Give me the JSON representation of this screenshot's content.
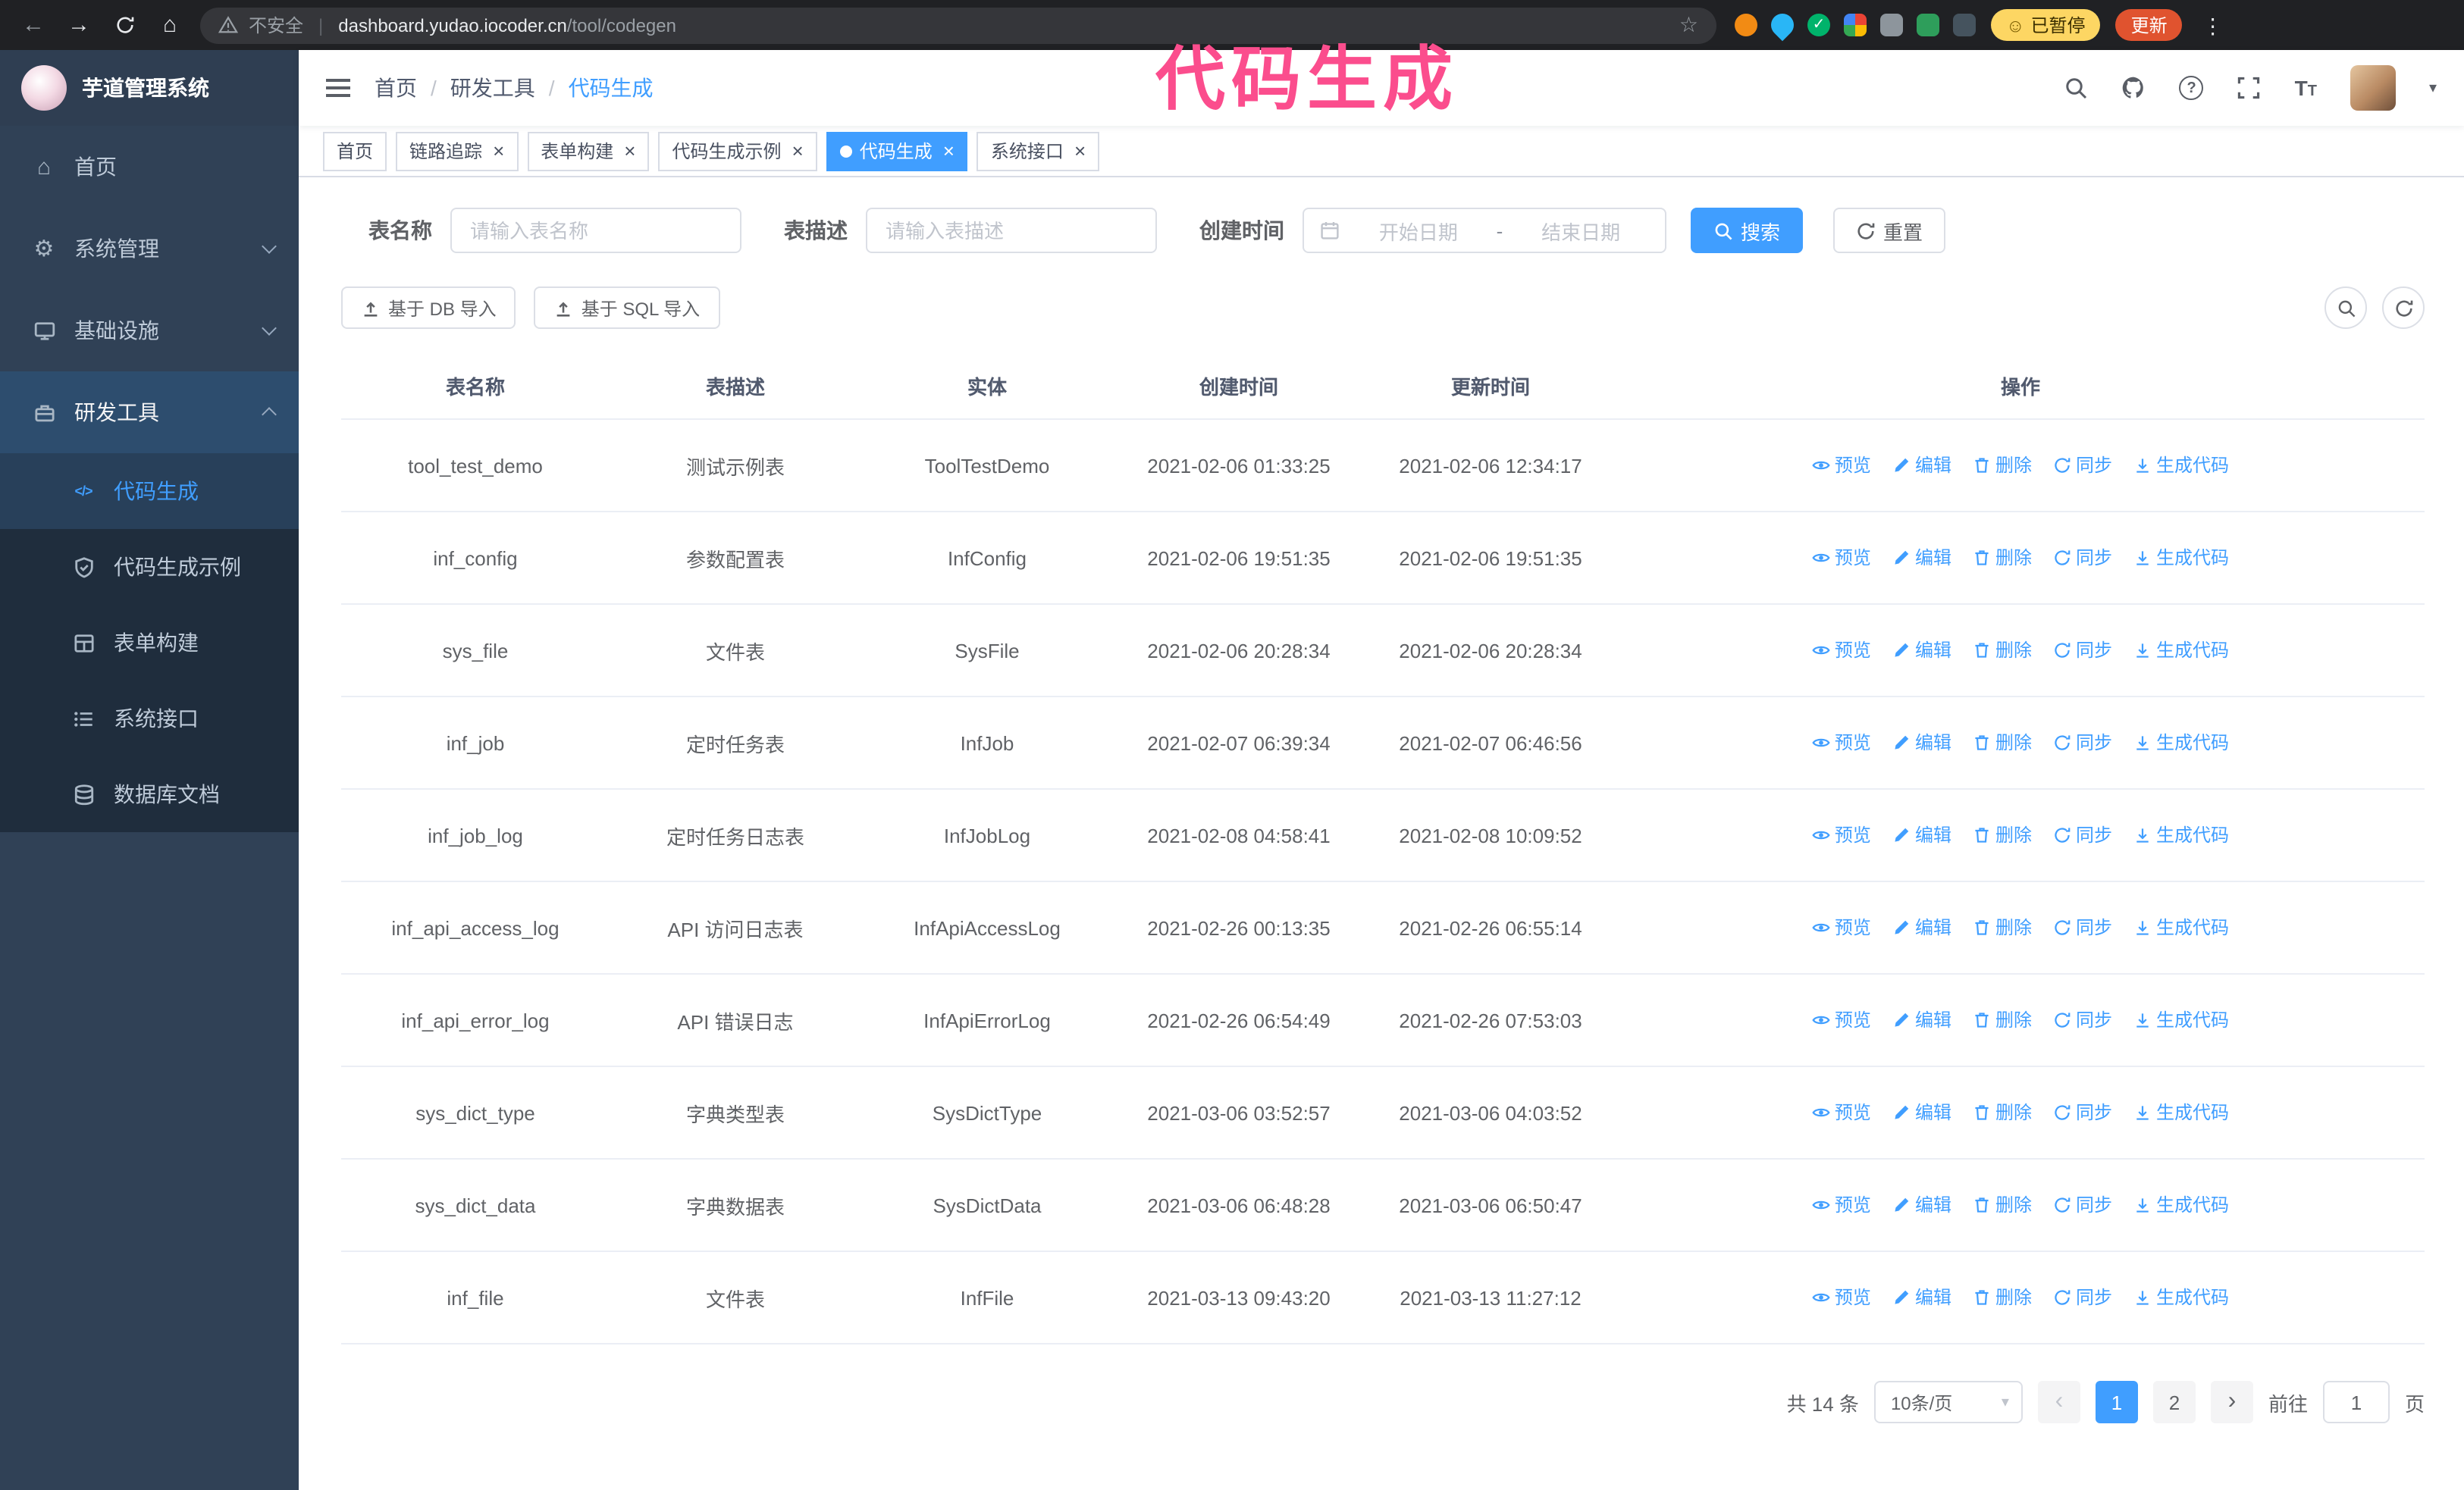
{
  "browser": {
    "security_text": "不安全",
    "url_domain": "dashboard.yudao.iocoder.cn",
    "url_path": "/tool/codegen",
    "paused_badge": "已暂停",
    "update_button": "更新"
  },
  "annotation": {
    "text": "代码生成",
    "color": "#fb4d8d"
  },
  "sidebar": {
    "logo_title": "芋道管理系统",
    "menu": [
      {
        "label": "首页"
      },
      {
        "label": "系统管理"
      },
      {
        "label": "基础设施"
      },
      {
        "label": "研发工具"
      }
    ],
    "submenu": [
      {
        "label": "代码生成"
      },
      {
        "label": "代码生成示例"
      },
      {
        "label": "表单构建"
      },
      {
        "label": "系统接口"
      },
      {
        "label": "数据库文档"
      }
    ]
  },
  "navbar": {
    "breadcrumb": [
      "首页",
      "研发工具",
      "代码生成"
    ]
  },
  "tabs": [
    {
      "label": "首页"
    },
    {
      "label": "链路追踪"
    },
    {
      "label": "表单构建"
    },
    {
      "label": "代码生成示例"
    },
    {
      "label": "代码生成"
    },
    {
      "label": "系统接口"
    }
  ],
  "filters": {
    "table_name_label": "表名称",
    "table_name_placeholder": "请输入表名称",
    "table_desc_label": "表描述",
    "table_desc_placeholder": "请输入表描述",
    "create_time_label": "创建时间",
    "date_start_placeholder": "开始日期",
    "date_separator": "-",
    "date_end_placeholder": "结束日期",
    "search_button": "搜索",
    "reset_button": "重置"
  },
  "toolbar": {
    "import_db_button": "基于 DB 导入",
    "import_sql_button": "基于 SQL 导入"
  },
  "table": {
    "columns": [
      "表名称",
      "表描述",
      "实体",
      "创建时间",
      "更新时间",
      "操作"
    ],
    "action_labels": [
      "预览",
      "编辑",
      "删除",
      "同步",
      "生成代码"
    ],
    "rows": [
      {
        "name": "tool_test_demo",
        "desc": "测试示例表",
        "entity": "ToolTestDemo",
        "created": "2021-02-06 01:33:25",
        "updated": "2021-02-06 12:34:17"
      },
      {
        "name": "inf_config",
        "desc": "参数配置表",
        "entity": "InfConfig",
        "created": "2021-02-06 19:51:35",
        "updated": "2021-02-06 19:51:35"
      },
      {
        "name": "sys_file",
        "desc": "文件表",
        "entity": "SysFile",
        "created": "2021-02-06 20:28:34",
        "updated": "2021-02-06 20:28:34"
      },
      {
        "name": "inf_job",
        "desc": "定时任务表",
        "entity": "InfJob",
        "created": "2021-02-07 06:39:34",
        "updated": "2021-02-07 06:46:56"
      },
      {
        "name": "inf_job_log",
        "desc": "定时任务日志表",
        "entity": "InfJobLog",
        "created": "2021-02-08 04:58:41",
        "updated": "2021-02-08 10:09:52"
      },
      {
        "name": "inf_api_access_log",
        "desc": "API 访问日志表",
        "entity": "InfApiAccessLog",
        "created": "2021-02-26 00:13:35",
        "updated": "2021-02-26 06:55:14"
      },
      {
        "name": "inf_api_error_log",
        "desc": "API 错误日志",
        "entity": "InfApiErrorLog",
        "created": "2021-02-26 06:54:49",
        "updated": "2021-02-26 07:53:03"
      },
      {
        "name": "sys_dict_type",
        "desc": "字典类型表",
        "entity": "SysDictType",
        "created": "2021-03-06 03:52:57",
        "updated": "2021-03-06 04:03:52"
      },
      {
        "name": "sys_dict_data",
        "desc": "字典数据表",
        "entity": "SysDictData",
        "created": "2021-03-06 06:48:28",
        "updated": "2021-03-06 06:50:47"
      },
      {
        "name": "inf_file",
        "desc": "文件表",
        "entity": "InfFile",
        "created": "2021-03-13 09:43:20",
        "updated": "2021-03-13 11:27:12"
      }
    ]
  },
  "pagination": {
    "total_text": "共 14 条",
    "page_size": "10条/页",
    "pages": [
      "1",
      "2"
    ],
    "active_page": "1",
    "goto_prefix": "前往",
    "goto_value": "1",
    "goto_suffix": "页"
  },
  "colors": {
    "primary": "#409eff",
    "sidebar_bg": "#304156",
    "submenu_bg": "#1f2d3d",
    "annotation": "#fb4d8d",
    "paused_badge_bg": "#fdd663",
    "update_button_bg": "#e0532f"
  }
}
